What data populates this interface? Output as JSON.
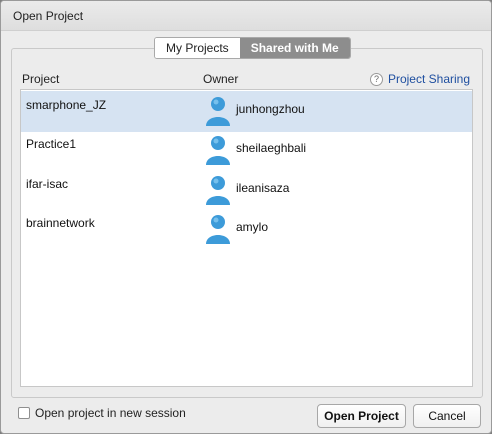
{
  "window": {
    "title": "Open Project"
  },
  "tabs": [
    {
      "label": "My Projects",
      "active": false
    },
    {
      "label": "Shared with Me",
      "active": true
    }
  ],
  "columns": {
    "project": "Project",
    "owner": "Owner"
  },
  "help": {
    "label": "Project Sharing",
    "icon": "question-icon",
    "glyph": "?"
  },
  "rows": [
    {
      "project": "smarphone_JZ",
      "owner": "junhongzhou",
      "selected": true
    },
    {
      "project": "Practice1",
      "owner": "sheilaeghbali",
      "selected": false
    },
    {
      "project": "ifar-isac",
      "owner": "ileanisaza",
      "selected": false
    },
    {
      "project": "brainnetwork",
      "owner": "amylo",
      "selected": false
    }
  ],
  "footer": {
    "new_session_label": "Open project in new session",
    "open_label": "Open Project",
    "cancel_label": "Cancel"
  },
  "colors": {
    "selection": "#d6e3f2",
    "link": "#1f4fa0",
    "active_tab": "#8d8d8d",
    "avatar": "#3d9bd9"
  }
}
